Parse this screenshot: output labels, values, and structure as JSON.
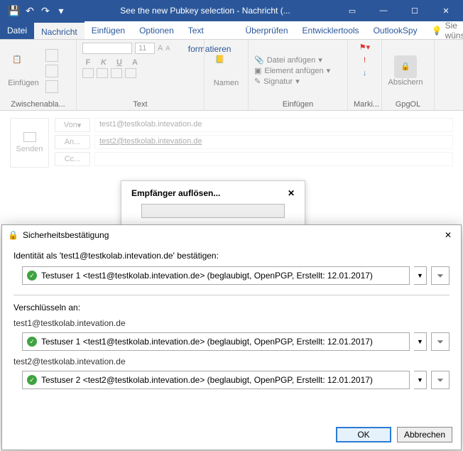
{
  "title": "See the new Pubkey selection  -  Nachricht (...",
  "tabs": {
    "file": "Datei",
    "message": "Nachricht",
    "insert": "Einfügen",
    "options": "Optionen",
    "format": "Text formatieren",
    "review": "Überprüfen",
    "devtools": "Entwicklertools",
    "outlookspy": "OutlookSpy",
    "tellme": "Sie wünsch"
  },
  "ribbon": {
    "clipboard": {
      "label": "Zwischenabla...",
      "paste": "Einfügen"
    },
    "text": {
      "label": "Text",
      "fontsize": "11"
    },
    "names": {
      "label": "Namen"
    },
    "include": {
      "label": "Einfügen",
      "attach_file": "Datei anfügen",
      "attach_item": "Element anfügen",
      "signature": "Signatur"
    },
    "tags": {
      "label": "Marki..."
    },
    "gpgol": {
      "label": "GpgOL",
      "secure": "Absichern"
    }
  },
  "mail": {
    "send": "Senden",
    "from_label": "Von",
    "from_value": "test1@testkolab.intevation.de",
    "to_label": "An...",
    "to_value": "test2@testkolab.intevation.de",
    "cc_label": "Cc..."
  },
  "resolve": {
    "title": "Empfänger auflösen..."
  },
  "dialog": {
    "title": "Sicherheitsbestätigung",
    "identity_label": "Identität als 'test1@testkolab.intevation.de' bestätigen:",
    "identity_key": "Testuser 1 <test1@testkolab.intevation.de> (beglaubigt, OpenPGP, Erstellt: 12.01.2017)",
    "encrypt_label": "Verschlüsseln an:",
    "recipients": [
      {
        "email": "test1@testkolab.intevation.de",
        "key": "Testuser 1 <test1@testkolab.intevation.de> (beglaubigt, OpenPGP, Erstellt: 12.01.2017)"
      },
      {
        "email": "test2@testkolab.intevation.de",
        "key": "Testuser 2 <test2@testkolab.intevation.de> (beglaubigt, OpenPGP, Erstellt: 12.01.2017)"
      }
    ],
    "ok": "OK",
    "cancel": "Abbrechen"
  }
}
